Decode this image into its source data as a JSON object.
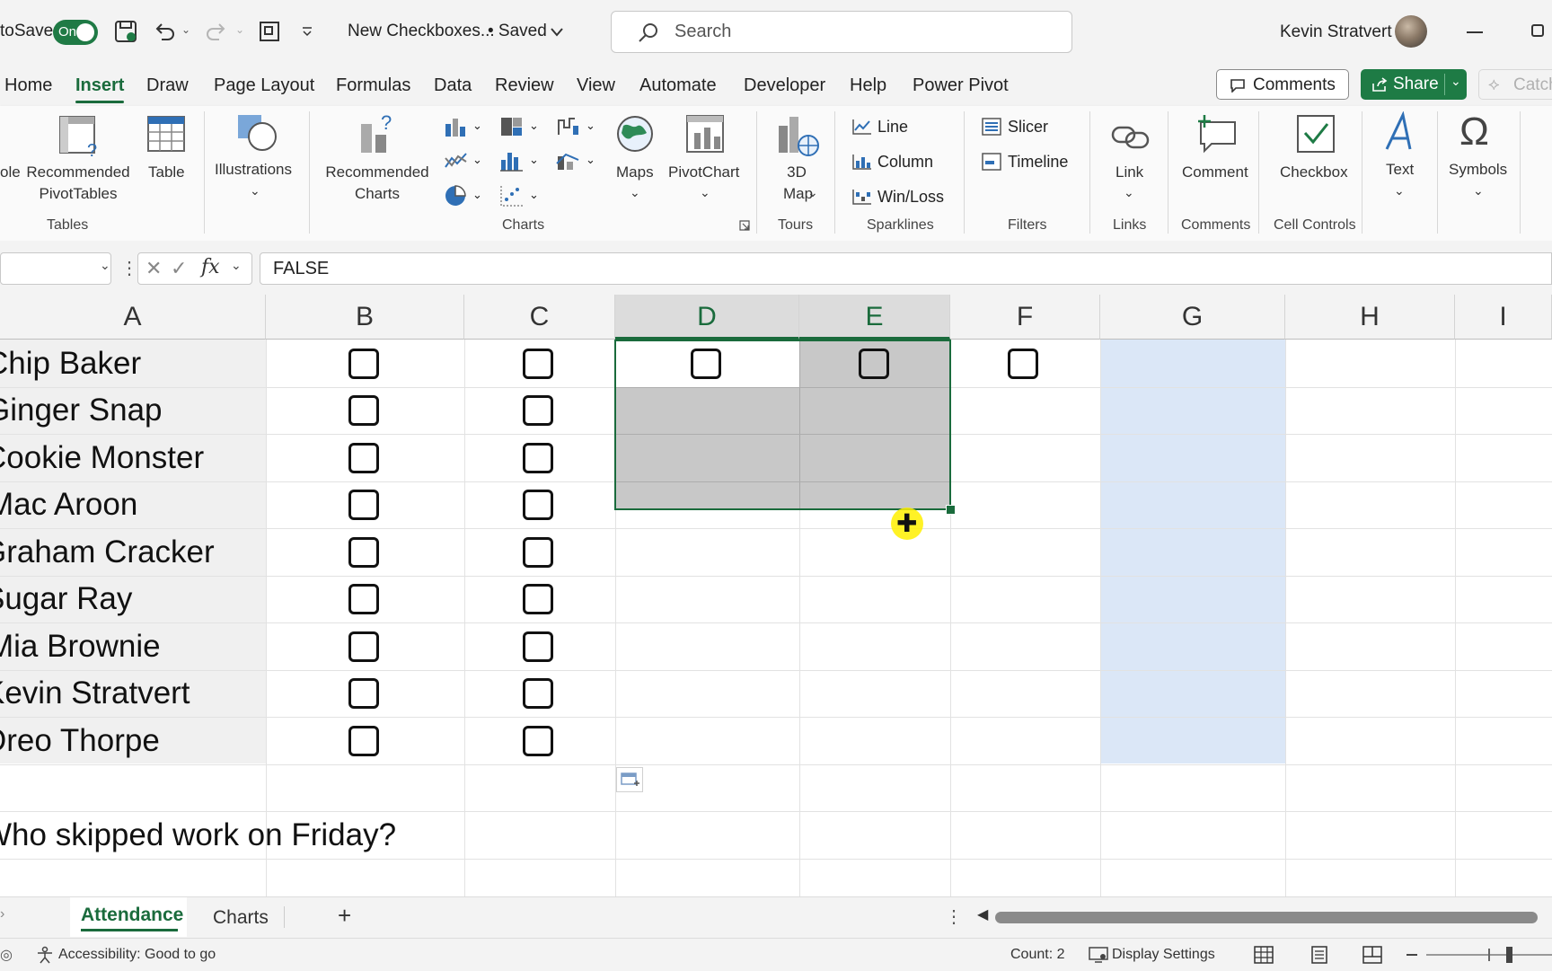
{
  "title_bar": {
    "autosave_label": "toSave",
    "toggle_state": "On",
    "filename": "New Checkboxes...",
    "saved_status": "• Saved",
    "search_placeholder": "Search",
    "user_name": "Kevin Stratvert"
  },
  "ribbon_tabs": [
    "Home",
    "Insert",
    "Draw",
    "Page Layout",
    "Formulas",
    "Data",
    "Review",
    "View",
    "Automate",
    "Developer",
    "Help",
    "Power Pivot"
  ],
  "active_tab": "Insert",
  "top_buttons": {
    "comments": "Comments",
    "share": "Share",
    "catch": "Catch"
  },
  "ribbon": {
    "pivot_partial": "ole",
    "recommended_pivot_1": "Recommended",
    "recommended_pivot_2": "PivotTables",
    "table": "Table",
    "illustrations": "Illustrations",
    "recommended_charts_1": "Recommended",
    "recommended_charts_2": "Charts",
    "maps": "Maps",
    "pivotchart": "PivotChart",
    "map3d_1": "3D",
    "map3d_2": "Map",
    "line": "Line",
    "column": "Column",
    "winloss": "Win/Loss",
    "slicer": "Slicer",
    "timeline": "Timeline",
    "link": "Link",
    "comment": "Comment",
    "checkbox": "Checkbox",
    "text": "Text",
    "symbols": "Symbols",
    "groups": {
      "tables": "Tables",
      "charts": "Charts",
      "tours": "Tours",
      "sparklines": "Sparklines",
      "filters": "Filters",
      "links": "Links",
      "comments": "Comments",
      "cell_controls": "Cell Controls"
    }
  },
  "formula_bar": {
    "value": "FALSE",
    "fx": "fx"
  },
  "columns": [
    "A",
    "B",
    "C",
    "D",
    "E",
    "F",
    "G",
    "H",
    "I"
  ],
  "selected_columns": [
    "D",
    "E"
  ],
  "names": [
    "Chip Baker",
    "Ginger Snap",
    "Cookie Monster",
    "Mac Aroon",
    "Graham Cracker",
    "Sugar Ray",
    "Mia Brownie",
    "Kevin Stratvert",
    "Oreo Thorpe"
  ],
  "question": "Who skipped work on Friday?",
  "sheets": {
    "active": "Attendance",
    "other": "Charts",
    "add": "+"
  },
  "status": {
    "accessibility": "Accessibility: Good to go",
    "count": "Count: 2",
    "display_settings": "Display Settings"
  },
  "colors": {
    "accent": "#1a6b3c",
    "share": "#1e7b45",
    "selection": "#c8c8c8",
    "column_g_highlight": "#dbe7f7"
  }
}
